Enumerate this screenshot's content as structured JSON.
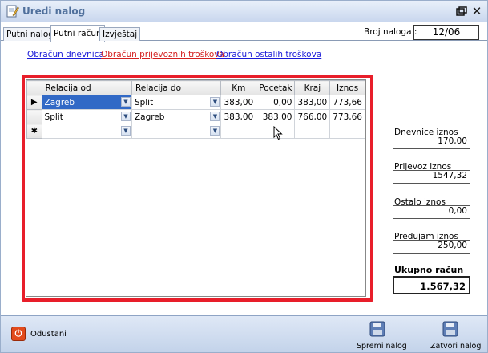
{
  "window": {
    "title": "Uredi nalog"
  },
  "tabs": [
    {
      "label": "Putni nalog"
    },
    {
      "label": "Putni račun"
    },
    {
      "label": "Izvještaj"
    }
  ],
  "broj_naloga": {
    "label": "Broj naloga :",
    "value": "12/06"
  },
  "links": {
    "dnevnica": "Obračun dnevnica",
    "prijevozni": "Obračun prijevoznih troškova",
    "ostali": "Obračun ostalih troškova"
  },
  "colors": {
    "link_blue": "#1a1ad8",
    "link_red": "#d42020",
    "frame_red": "#e81e2a",
    "selection": "#3169c6"
  },
  "grid": {
    "columns": [
      "Relacija od",
      "Relacija do",
      "Km",
      "Pocetak",
      "Kraj",
      "Iznos"
    ],
    "rows": [
      {
        "indicator": "▶",
        "od": "Zagreb",
        "do": "Split",
        "km": "383,00",
        "pocetak": "0,00",
        "kraj": "383,00",
        "iznos": "773,66"
      },
      {
        "indicator": "",
        "od": "Split",
        "do": "Zagreb",
        "km": "383,00",
        "pocetak": "383,00",
        "kraj": "766,00",
        "iznos": "773,66"
      }
    ],
    "new_row_indicator": "✱"
  },
  "summary": {
    "dnevnice_label": "Dnevnice iznos",
    "dnevnice_value": "170,00",
    "prijevoz_label": "Prijevoz iznos",
    "prijevoz_value": "1547,32",
    "ostalo_label": "Ostalo iznos",
    "ostalo_value": "0,00",
    "predujam_label": "Predujam iznos",
    "predujam_value": "250,00",
    "ukupno_label": "Ukupno račun",
    "ukupno_value": "1.567,32"
  },
  "bottom": {
    "odustani": "Odustani",
    "spremi": "Spremi nalog",
    "zatvori": "Zatvori nalog"
  },
  "icons": [
    "document-edit-icon",
    "restore-icon",
    "close-icon",
    "power-icon",
    "floppy-save-icon",
    "dropdown-arrow-icon",
    "mouse-cursor-icon"
  ]
}
